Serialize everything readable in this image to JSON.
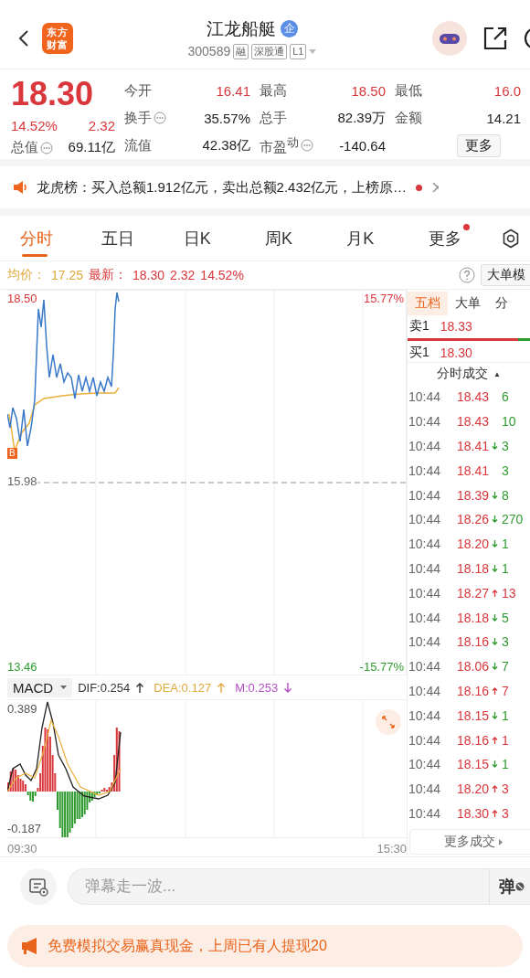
{
  "header": {
    "logo": "东方财富",
    "title": "江龙船艇",
    "title_badge": "企",
    "code": "300589",
    "tags": [
      "融",
      "深股通",
      "L1"
    ]
  },
  "quote": {
    "price": "18.30",
    "change_pct": "14.52%",
    "change": "2.32",
    "total_value": {
      "label": "总值",
      "value": "69.11亿",
      "info": true
    },
    "stats": [
      {
        "label": "今开",
        "value": "16.41",
        "rising": true,
        "info": false
      },
      {
        "label": "最高",
        "value": "18.50",
        "rising": true,
        "info": false
      },
      {
        "label": "最低",
        "value": "16.0",
        "rising": true,
        "info": false
      },
      {
        "label": "换手",
        "value": "35.57%",
        "rising": false,
        "info": true
      },
      {
        "label": "总手",
        "value": "82.39万",
        "rising": false,
        "info": false
      },
      {
        "label": "金额",
        "value": "14.21",
        "rising": false,
        "info": false
      },
      {
        "label": "流值",
        "value": "42.38亿",
        "rising": false,
        "info": false
      },
      {
        "label": "市盈$^{动}$",
        "value": "-140.64",
        "rising": false,
        "info": true
      }
    ],
    "more_button": "更多"
  },
  "ticker": {
    "text": "龙虎榜：买入总额1.912亿元，卖出总额2.432亿元，上榜原…",
    "unread": true
  },
  "tabs": [
    {
      "label": "分时",
      "selected": true,
      "dot": false
    },
    {
      "label": "五日",
      "selected": false,
      "dot": false
    },
    {
      "label": "日K",
      "selected": false,
      "dot": false
    },
    {
      "label": "周K",
      "selected": false,
      "dot": false
    },
    {
      "label": "月K",
      "selected": false,
      "dot": false
    },
    {
      "label": "更多",
      "selected": false,
      "dot": true
    }
  ],
  "info_row": {
    "avg_label": "均价：",
    "avg": "17.25",
    "latest_label": "最新：",
    "latest": "18.30",
    "change": "2.32",
    "change_pct": "14.52%",
    "mode_button": "大单模"
  },
  "chart": {
    "high": "18.50",
    "mid": "15.98",
    "low": "13.46",
    "high_pct": "15.77%",
    "low_pct": "-15.77%",
    "marker": "B"
  },
  "macd": {
    "selector": "MACD",
    "dif": "DIF:0.254",
    "dif_rising": true,
    "dea": "DEA:0.127",
    "dea_rising": true,
    "m": "M:0.253",
    "m_rising": false,
    "max": "0.389",
    "min": "-0.187",
    "start_time": "09:30",
    "end_time": "15:30"
  },
  "book": {
    "tabs": [
      {
        "label": "五档",
        "selected": true
      },
      {
        "label": "大单",
        "selected": false
      },
      {
        "label": "分",
        "selected": false
      }
    ],
    "sell": {
      "label": "卖1",
      "price": "18.33"
    },
    "buy": {
      "label": "买1",
      "price": "18.30"
    },
    "level": 0.9,
    "trades_title": "分时成交",
    "sort_arrow": "▲",
    "trades": [
      {
        "time": "10:44",
        "price": "18.43",
        "rise": false,
        "fall": false,
        "volume": "6",
        "buy": false
      },
      {
        "time": "10:44",
        "price": "18.43",
        "rise": false,
        "fall": false,
        "volume": "10",
        "buy": false
      },
      {
        "time": "10:44",
        "price": "18.41",
        "rise": false,
        "fall": true,
        "volume": "3",
        "buy": false
      },
      {
        "time": "10:44",
        "price": "18.41",
        "rise": false,
        "fall": false,
        "volume": "3",
        "buy": false
      },
      {
        "time": "10:44",
        "price": "18.39",
        "rise": false,
        "fall": true,
        "volume": "8",
        "buy": false
      },
      {
        "time": "10:44",
        "price": "18.26",
        "rise": false,
        "fall": true,
        "volume": "270",
        "buy": false
      },
      {
        "time": "10:44",
        "price": "18.20",
        "rise": false,
        "fall": true,
        "volume": "1",
        "buy": false
      },
      {
        "time": "10:44",
        "price": "18.18",
        "rise": false,
        "fall": true,
        "volume": "1",
        "buy": false
      },
      {
        "time": "10:44",
        "price": "18.27",
        "rise": true,
        "fall": false,
        "volume": "13",
        "buy": true
      },
      {
        "time": "10:44",
        "price": "18.18",
        "rise": false,
        "fall": true,
        "volume": "5",
        "buy": false
      },
      {
        "time": "10:44",
        "price": "18.16",
        "rise": false,
        "fall": true,
        "volume": "3",
        "buy": false
      },
      {
        "time": "10:44",
        "price": "18.06",
        "rise": false,
        "fall": true,
        "volume": "7",
        "buy": false
      },
      {
        "time": "10:44",
        "price": "18.16",
        "rise": true,
        "fall": false,
        "volume": "7",
        "buy": true
      },
      {
        "time": "10:44",
        "price": "18.15",
        "rise": false,
        "fall": true,
        "volume": "1",
        "buy": false
      },
      {
        "time": "10:44",
        "price": "18.16",
        "rise": true,
        "fall": false,
        "volume": "1",
        "buy": true
      },
      {
        "time": "10:44",
        "price": "18.15",
        "rise": false,
        "fall": true,
        "volume": "1",
        "buy": false
      },
      {
        "time": "10:44",
        "price": "18.20",
        "rise": true,
        "fall": false,
        "volume": "3",
        "buy": true
      },
      {
        "time": "10:44",
        "price": "18.30",
        "rise": true,
        "fall": false,
        "volume": "3",
        "buy": true
      }
    ],
    "more_button": "更多成交"
  },
  "comment_bar": {
    "placeholder": "弹幕走一波...",
    "danmaku_button": "弹"
  },
  "banner": {
    "text": "免费模拟交易赢真现金，上周已有人提现20"
  }
}
